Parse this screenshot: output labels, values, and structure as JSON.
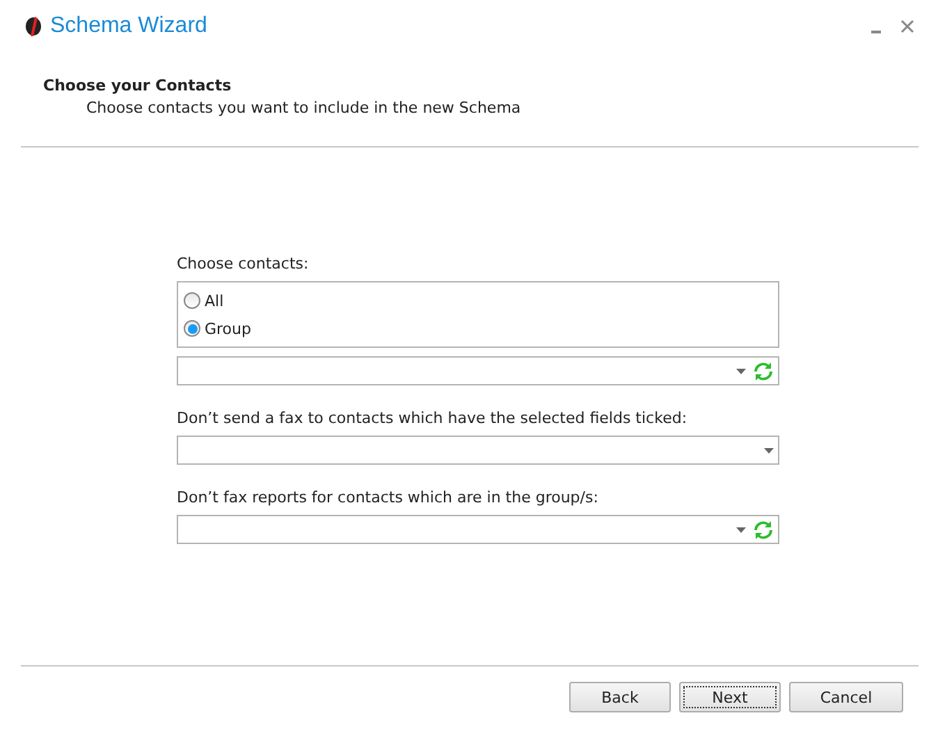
{
  "window": {
    "title": "Schema Wizard"
  },
  "header": {
    "title": "Choose your Contacts",
    "subtitle": "Choose contacts you want to include in the new Schema"
  },
  "contacts": {
    "label": "Choose contacts:",
    "options": [
      {
        "label": "All",
        "selected": false
      },
      {
        "label": "Group",
        "selected": true
      }
    ],
    "group_combo": {
      "refresh": true
    }
  },
  "fields": [
    {
      "label": "Don’t send a fax to contacts which have the selected fields ticked:",
      "refresh": false
    },
    {
      "label": "Don’t fax reports for contacts which are in the group/s:",
      "refresh": true
    }
  ],
  "buttons": [
    {
      "label": "Back",
      "focused": false
    },
    {
      "label": "Next",
      "focused": true
    },
    {
      "label": "Cancel",
      "focused": false
    }
  ]
}
